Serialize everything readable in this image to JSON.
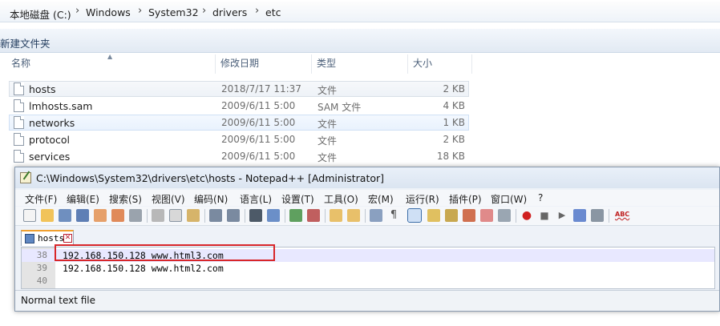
{
  "explorer": {
    "breadcrumb": [
      "本地磁盘 (C:)",
      "Windows",
      "System32",
      "drivers",
      "etc"
    ],
    "new_folder_label": "新建文件夹",
    "columns": {
      "name": "名称",
      "modified": "修改日期",
      "type": "类型",
      "size": "大小"
    },
    "files": [
      {
        "name": "hosts",
        "modified": "2018/7/17 11:37",
        "type": "文件",
        "size": "2 KB"
      },
      {
        "name": "lmhosts.sam",
        "modified": "2009/6/11 5:00",
        "type": "SAM 文件",
        "size": "4 KB"
      },
      {
        "name": "networks",
        "modified": "2009/6/11 5:00",
        "type": "文件",
        "size": "1 KB"
      },
      {
        "name": "protocol",
        "modified": "2009/6/11 5:00",
        "type": "文件",
        "size": "2 KB"
      },
      {
        "name": "services",
        "modified": "2009/6/11 5:00",
        "type": "文件",
        "size": "18 KB"
      }
    ]
  },
  "notepad": {
    "title": "C:\\Windows\\System32\\drivers\\etc\\hosts - Notepad++ [Administrator]",
    "menu": [
      "文件(F)",
      "编辑(E)",
      "搜索(S)",
      "视图(V)",
      "编码(N)",
      "语言(L)",
      "设置(T)",
      "工具(O)",
      "宏(M)",
      "运行(R)",
      "插件(P)",
      "窗口(W)",
      "?"
    ],
    "tab_label": "hosts",
    "lines": [
      {
        "number": "38",
        "text": "192.168.150.128 www.html3.com"
      },
      {
        "number": "39",
        "text": "192.168.150.128 www.html2.com"
      },
      {
        "number": "40",
        "text": ""
      }
    ],
    "status": "Normal text file"
  }
}
